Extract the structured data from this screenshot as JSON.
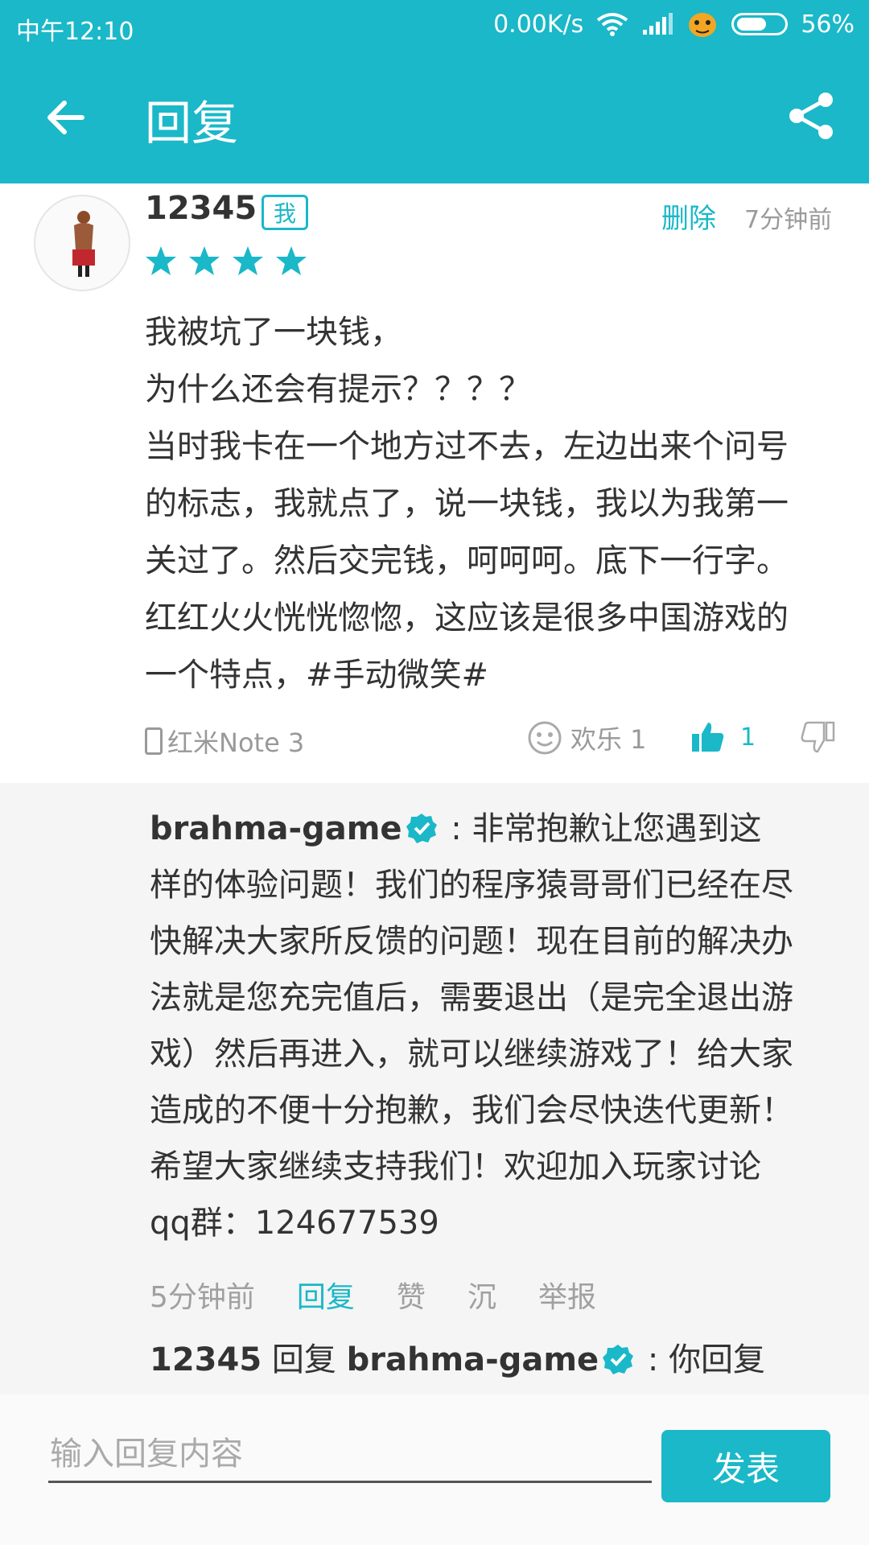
{
  "status_bar": {
    "time": "中午12:10",
    "net_speed": "0.00K/s",
    "battery": "56%"
  },
  "app_bar": {
    "title": "回复"
  },
  "comment": {
    "username": "12345",
    "badge": "我",
    "delete_label": "删除",
    "time_ago": "7分钟前",
    "rating": 4,
    "body": "我被坑了一块钱，\n为什么还会有提示？？？？\n当时我卡在一个地方过不去，左边出来个问号\n的标志，我就点了，说一块钱，我以为我第一\n关过了。然后交完钱，呵呵呵。底下一行字。\n红红火火恍恍惚惚，这应该是很多中国游戏的\n一个特点，#手动微笑#",
    "device": "红米Note 3",
    "happy_label": "欢乐 1",
    "like_count": "1"
  },
  "replies": [
    {
      "author": "brahma-game",
      "separator": " : ",
      "text": "非常抱歉让您遇到这样的体验问题！我们的程序猿哥哥们已经在尽快解决大家所反馈的问题！现在目前的解决办法就是您充完值后，需要退出（是完全退出游戏）然后再进入，就可以继续游戏了！给大家造成的不便十分抱歉，我们会尽快迭代更新！希望大家继续支持我们！欢迎加入玩家讨论qq群：124677539",
      "time_ago": "5分钟前",
      "actions": [
        "回复",
        "赞",
        "沉",
        "举报"
      ]
    },
    {
      "author": "12345",
      "reply_word": " 回复 ",
      "target": "brahma-game",
      "separator": " : ",
      "text": "你回复错了谢"
    }
  ],
  "input": {
    "placeholder": "输入回复内容",
    "submit_label": "发表"
  },
  "colors": {
    "accent": "#1ab8c8"
  }
}
